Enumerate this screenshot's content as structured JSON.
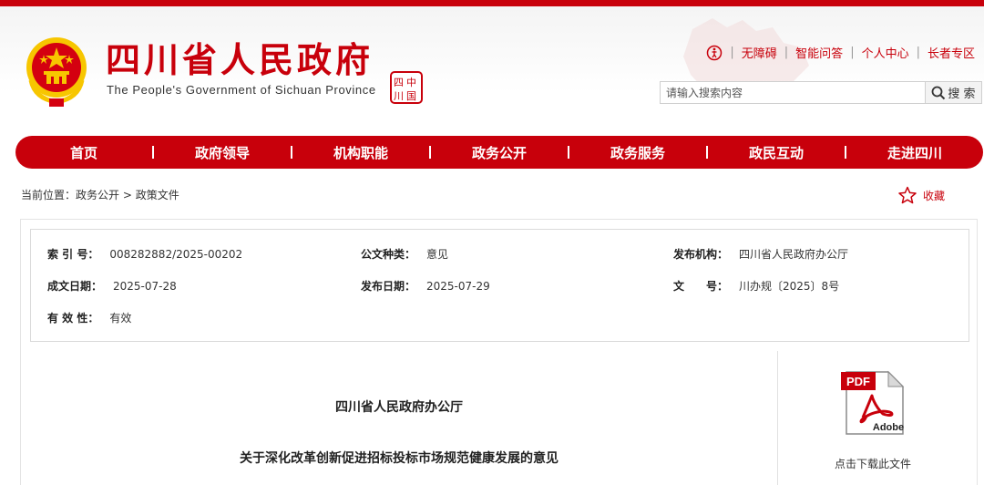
{
  "header": {
    "title": "四川省人民政府",
    "subtitle": "The People's Government of Sichuan Province",
    "seal_text": "四川",
    "utility_links": [
      "无障碍",
      "智能问答",
      "个人中心",
      "长者专区"
    ],
    "search": {
      "placeholder": "请输入搜索内容",
      "button_label": "搜 索"
    },
    "colors": {
      "brand_red": "#c8000b",
      "gold": "#f7c600"
    }
  },
  "nav": {
    "items": [
      "首页",
      "政府领导",
      "机构职能",
      "政务公开",
      "政务服务",
      "政民互动",
      "走进四川"
    ]
  },
  "breadcrumb": {
    "prefix": "当前位置：",
    "items": [
      "政务公开",
      "政策文件"
    ],
    "separator": " > "
  },
  "favorite": {
    "label": "收藏"
  },
  "metadata": {
    "index_label": "索 引 号：",
    "index_value": "008282882/2025-00202",
    "type_label": "公文种类：",
    "type_value": "意见",
    "publisher_label": "发布机构：",
    "publisher_value": "四川省人民政府办公厅",
    "created_label": "成文日期：",
    "created_value": "2025-07-28",
    "published_label": "发布日期：",
    "published_value": "2025-07-29",
    "docno_label": "文　　号：",
    "docno_value": "川办规〔2025〕8号",
    "validity_label": "有 效 性：",
    "validity_value": "有效"
  },
  "document": {
    "issuer": "四川省人民政府办公厅",
    "title": "关于深化改革创新促进招标投标市场规范健康发展的意见"
  },
  "download": {
    "pdf_badge": "PDF",
    "brand": "Adobe",
    "label": "点击下载此文件"
  }
}
